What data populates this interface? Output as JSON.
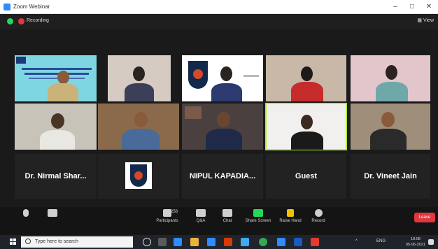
{
  "window": {
    "title": "Zoom Webinar",
    "minimize": "–",
    "maximize": "□",
    "close": "✕"
  },
  "topbar": {
    "recording_label": "Recording",
    "view_label": "View"
  },
  "tiles": {
    "name_1": "Dr. Nirmal Shar...",
    "name_2": "NIPUL  KAPADIA...",
    "name_3": "Guest",
    "name_4": "Dr. Vineet Jain",
    "logo_text": "RMU"
  },
  "controls": {
    "participants_label": "Participants",
    "participants_count": "258",
    "qa_label": "Q&A",
    "chat_label": "Chat",
    "share_label": "Share Screen",
    "raise_label": "Raise Hand",
    "record_label": "Record",
    "leave_label": "Leave"
  },
  "taskbar": {
    "search_placeholder": "Type here to search",
    "lang": "ENG",
    "time": "18:08",
    "date": "05-06-2021"
  },
  "colors": {
    "zoom_blue": "#2d8cff",
    "recording_red": "#e0383e",
    "active_speaker": "#aef02c",
    "share_green": "#23d959"
  }
}
